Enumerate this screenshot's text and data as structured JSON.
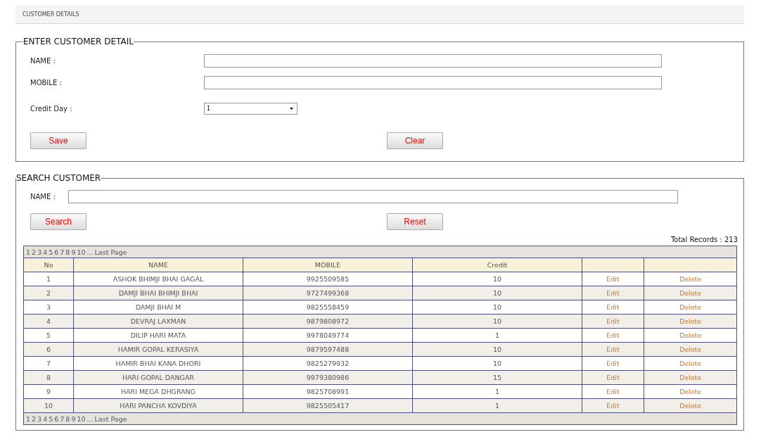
{
  "header": {
    "title": "CUSTOMER DETAILS"
  },
  "entry": {
    "legend": "ENTER CUSTOMER DETAIL",
    "name_label": "NAME :",
    "mobile_label": "MOBILE :",
    "credit_label": "Credit Day :",
    "credit_value": "1",
    "buttons": [
      "Save",
      "Clear"
    ]
  },
  "search": {
    "legend": "SEARCH CUSTOMER",
    "name_label": "NAME :",
    "buttons": [
      "Search",
      "Reset"
    ],
    "total": "Total Records : 213"
  },
  "top_pager": [
    "1",
    "2",
    "3",
    "4",
    "5",
    "6",
    "7",
    "8",
    "9",
    "10",
    "...",
    "Last Page"
  ],
  "bottom_pager": [
    "1",
    "2",
    "3",
    "4",
    "5",
    "6",
    "7",
    "8",
    "9",
    "10",
    "...",
    "Last Page"
  ],
  "table": {
    "columns": [
      "No",
      "NAME",
      "MOBILE",
      "Credit",
      "",
      ""
    ],
    "rows": [
      [
        "1",
        "ASHOK BHIMJI BHAI GAGAL",
        "9925509585",
        "10",
        "Edit",
        "Delete"
      ],
      [
        "2",
        "DAMJI BHAI BHIMJI BHAI",
        "9727499368",
        "10",
        "Edit",
        "Delete"
      ],
      [
        "3",
        "DAMJI BHAI M",
        "9825558459",
        "10",
        "Edit",
        "Delete"
      ],
      [
        "4",
        "DEVRAJ LAXMAN",
        "9879808972",
        "10",
        "Edit",
        "Delete"
      ],
      [
        "5",
        "DILIP HARI MATA",
        "9978049774",
        "1",
        "Edit",
        "Delete"
      ],
      [
        "6",
        "HAMIR GOPAL KERASIYA",
        "9879597488",
        "10",
        "Edit",
        "Delete"
      ],
      [
        "7",
        "HAMIR BHAI KANA DHORI",
        "9825279932",
        "10",
        "Edit",
        "Delete"
      ],
      [
        "8",
        "HARI GOPAL DANGAR",
        "9979380986",
        "15",
        "Edit",
        "Delete"
      ],
      [
        "9",
        "HARI MEGA DHGRANG",
        "9825708991",
        "1",
        "Edit",
        "Delete"
      ],
      [
        "10",
        "HARI PANCHA KOVDIYA",
        "9825505417",
        "1",
        "Edit",
        "Delete"
      ]
    ]
  }
}
